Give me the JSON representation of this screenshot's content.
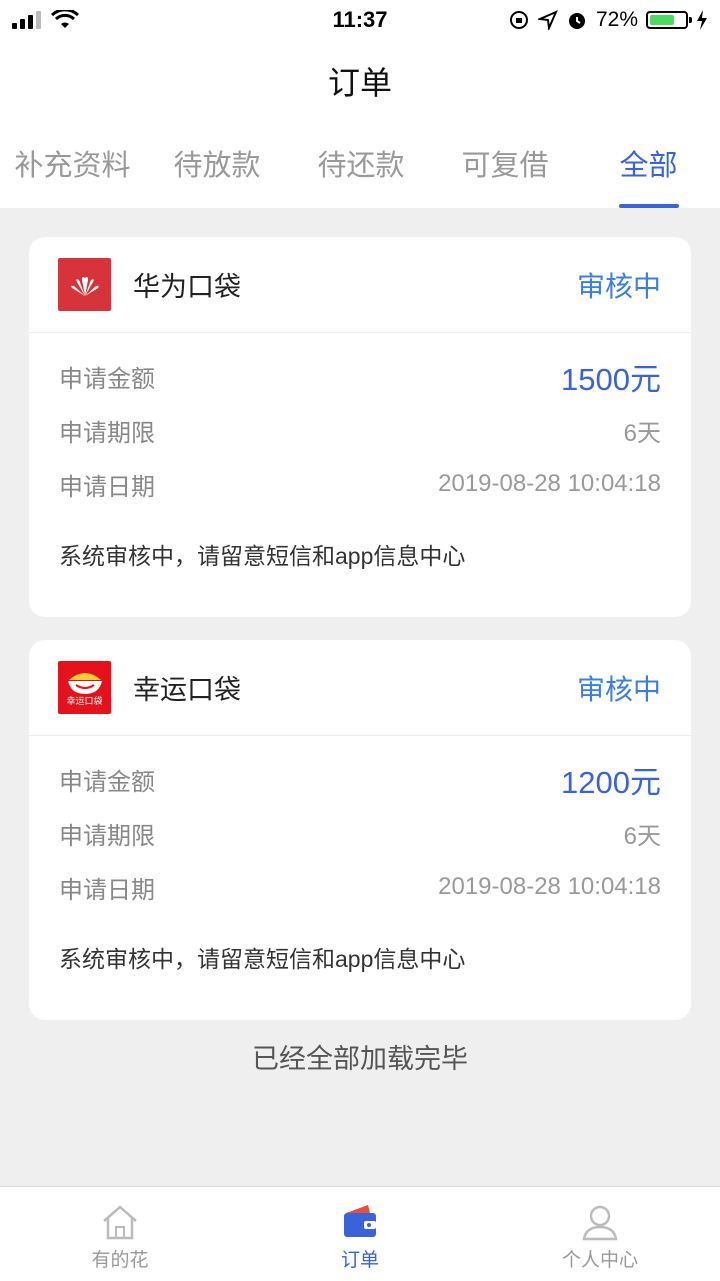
{
  "status_bar": {
    "time": "11:37",
    "battery": "72%"
  },
  "header": {
    "title": "订单"
  },
  "tabs": [
    {
      "label": "补充资料"
    },
    {
      "label": "待放款"
    },
    {
      "label": "待还款"
    },
    {
      "label": "可复借"
    },
    {
      "label": "全部"
    }
  ],
  "active_tab": "全部",
  "orders": [
    {
      "name": "华为口袋",
      "status": "审核中",
      "amount_label": "申请金额",
      "amount": "1500元",
      "term_label": "申请期限",
      "term": "6天",
      "date_label": "申请日期",
      "date": "2019-08-28 10:04:18",
      "note": "系统审核中，请留意短信和app信息中心",
      "logo_color": "#d6333b"
    },
    {
      "name": "幸运口袋",
      "status": "审核中",
      "amount_label": "申请金额",
      "amount": "1200元",
      "term_label": "申请期限",
      "term": "6天",
      "date_label": "申请日期",
      "date": "2019-08-28 10:04:18",
      "note": "系统审核中，请留意短信和app信息中心",
      "logo_color": "#e5121b",
      "logo_text": "幸运口袋"
    }
  ],
  "footer_message": "已经全部加载完毕",
  "tabbar": [
    {
      "label": "有的花",
      "icon": "home-icon"
    },
    {
      "label": "订单",
      "icon": "wallet-icon"
    },
    {
      "label": "个人中心",
      "icon": "user-icon"
    }
  ],
  "colors": {
    "accent": "#3b63d9",
    "status": "#3c7fe0",
    "background": "#efefef"
  }
}
